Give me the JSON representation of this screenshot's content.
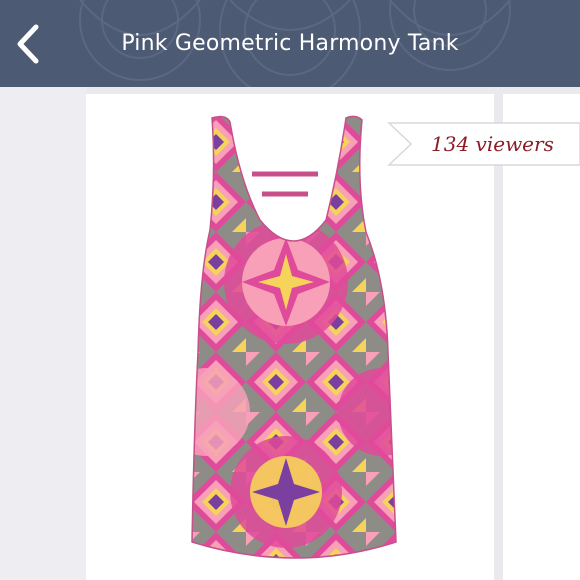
{
  "header": {
    "title": "Pink Geometric Harmony Tank",
    "back_icon": "chevron-left-icon",
    "background": "#4d5a73"
  },
  "listing": {
    "viewers_label": "134 viewers",
    "viewers_color": "#8a1c26"
  },
  "product": {
    "image": "tank-top-photo",
    "print_colors": [
      "#e04a9a",
      "#f7a0b8",
      "#f6d35a",
      "#8e8c86",
      "#7b3fa0"
    ]
  }
}
